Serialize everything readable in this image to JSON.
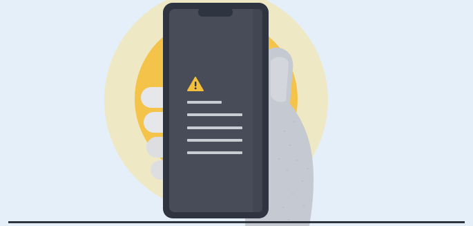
{
  "illustration": {
    "subject": "hand-holding-phone-with-warning",
    "icon": "warning-icon",
    "colors": {
      "background": "#e4eff9",
      "halo_outer": "#f0e9c4",
      "halo_inner": "#f3c34a",
      "phone_body": "#2f3540",
      "phone_screen": "#474c58",
      "warning_fill": "#f4bf3a",
      "text_lines": "#c9ccd2",
      "hand": "#c9cdd4",
      "thumb": "#e8e9ec",
      "ground_line": "#30343c"
    }
  }
}
